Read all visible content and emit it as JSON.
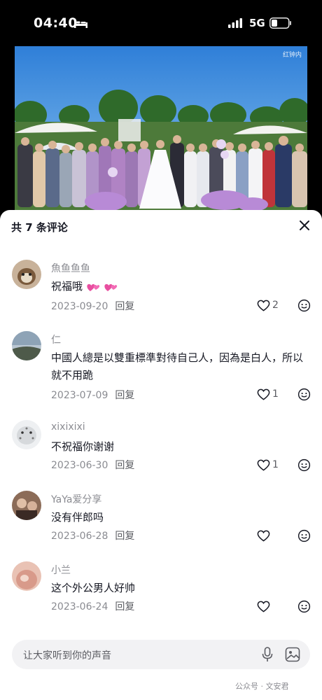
{
  "status_bar": {
    "time": "04:40",
    "network": "5G"
  },
  "video": {
    "watermark": "红钟内"
  },
  "sheet": {
    "header": "共 7 条评论",
    "reply_label": "回复",
    "comments": [
      {
        "author": "魚鱼鱼鱼",
        "text": "祝福哦",
        "date": "2023-09-20",
        "likes": "2",
        "avatar_color": "#8a6a4a"
      },
      {
        "author": "仁",
        "text": "中國人總是以雙重標準對待自己人，因為是白人，所以就不用跪",
        "date": "2023-07-09",
        "likes": "1",
        "avatar_color": "#7a8a9a"
      },
      {
        "author": "xixixixi",
        "text": "不祝福你谢谢",
        "date": "2023-06-30",
        "likes": "1",
        "avatar_color": "#cfd3d6"
      },
      {
        "author": "YaYa爱分享",
        "text": "没有伴郎吗",
        "date": "2023-06-28",
        "likes": "",
        "avatar_color": "#6a4a3a"
      },
      {
        "author": "小兰",
        "text": "这个外公男人好帅",
        "date": "2023-06-24",
        "likes": "",
        "avatar_color": "#d9a89a"
      }
    ]
  },
  "input": {
    "placeholder": "让大家听到你的声音"
  },
  "footer_watermark": "公众号 · 文安君"
}
